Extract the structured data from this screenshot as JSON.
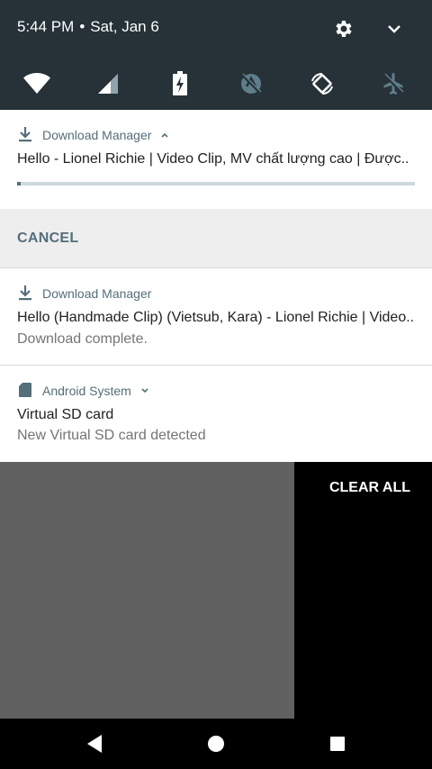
{
  "status_bar": {
    "time": "5:44 PM",
    "separator": "•",
    "date": "Sat, Jan 6"
  },
  "quick_settings": {
    "tiles": [
      {
        "icon": "wifi-icon"
      },
      {
        "icon": "cellular-signal-icon"
      },
      {
        "icon": "battery-charging-icon"
      },
      {
        "icon": "location-off-icon"
      },
      {
        "icon": "auto-rotate-icon"
      },
      {
        "icon": "airplane-mode-off-icon"
      }
    ]
  },
  "notifications": [
    {
      "app": "Download Manager",
      "title": "Hello - Lionel Richie | Video Clip, MV chất lượng cao | Được..",
      "progress": 0.01,
      "action": "CANCEL"
    },
    {
      "app": "Download Manager",
      "title": "Hello (Handmade Clip) (Vietsub, Kara) - Lionel Richie | Video..",
      "subtitle": "Download complete."
    },
    {
      "app": "Android System",
      "title": "Virtual SD card",
      "subtitle": "New Virtual SD card detected"
    }
  ],
  "clear_all": "CLEAR ALL",
  "colors": {
    "shade": "#263238",
    "accent": "#546e7a",
    "card": "#ffffff"
  }
}
